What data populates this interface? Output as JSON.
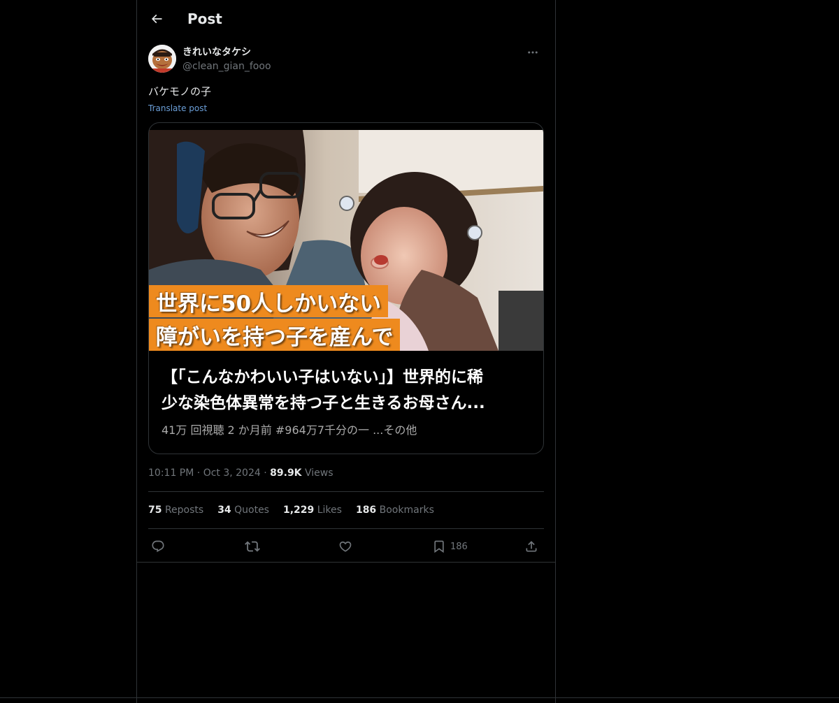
{
  "header": {
    "title": "Post"
  },
  "author": {
    "display_name": "きれいなタケシ",
    "handle": "@clean_gian_fooo"
  },
  "post": {
    "text": "バケモノの子",
    "translate_label": "Translate post"
  },
  "card": {
    "thumbnail_caption_line1": "世界に50人しかいない",
    "thumbnail_caption_line2": "障がいを持つ子を産んで",
    "title_line1": "【「こんなかわいい子はいない」】世界的に稀",
    "title_line2": "少な染色体異常を持つ子と生きるお母さん...",
    "meta": "41万 回視聴  2 か月前  #964万7千分の一  ...その他"
  },
  "timestamp": {
    "time": "10:11 PM",
    "separator": "·",
    "date": "Oct 3, 2024",
    "views_count": "89.9K",
    "views_label": "Views"
  },
  "stats": {
    "reposts_count": "75",
    "reposts_label": "Reposts",
    "quotes_count": "34",
    "quotes_label": "Quotes",
    "likes_count": "1,229",
    "likes_label": "Likes",
    "bookmarks_count": "186",
    "bookmarks_label": "Bookmarks"
  },
  "actions": {
    "reply_icon": "reply-icon",
    "repost_icon": "repost-icon",
    "like_icon": "heart-icon",
    "bookmark_icon": "bookmark-icon",
    "bookmark_count": "186",
    "share_icon": "share-icon"
  },
  "colors": {
    "background": "#000000",
    "text_primary": "#e7e9ea",
    "text_secondary": "#71767b",
    "link": "#6b9fd8",
    "border": "#2f3336",
    "caption_band": "#ee8a1e"
  }
}
